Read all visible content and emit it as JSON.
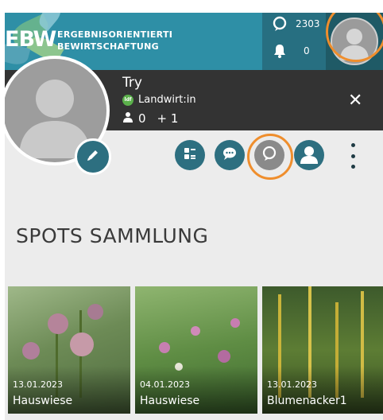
{
  "header": {
    "logo_abbr": "EBW",
    "logo_line1": "ERGEBNISORIENTIERTE",
    "logo_line2": "BEWIRTSCHAFTUNG",
    "points_value": "2303",
    "notifications_value": "0"
  },
  "profile": {
    "name": "Try",
    "role_badge": "ldf",
    "role": "Landwirt:in",
    "followers": "0",
    "following": "+ 1"
  },
  "section": {
    "title": "SPOTS SAMMLUNG"
  },
  "spots": [
    {
      "date": "13.01.2023",
      "name": "Hauswiese"
    },
    {
      "date": "04.01.2023",
      "name": "Hauswiese"
    },
    {
      "date": "13.01.2023",
      "name": "Blumenacker1"
    }
  ],
  "colors": {
    "header_teal": "#2e8fa6",
    "stats_teal": "#276f81",
    "profile_dark": "#333333",
    "accent_teal": "#2d6f80",
    "highlight_orange": "#ef8e2d",
    "role_green": "#5bb04b"
  },
  "icons": {
    "points": "speech-bubble-icon",
    "notifications": "bell-icon",
    "profile": "user-avatar-icon",
    "edit": "pencil-icon",
    "list": "list-icon",
    "chat": "chat-icon",
    "spot": "spot-icon",
    "user": "user-icon",
    "more": "vertical-dots-icon",
    "close": "close-icon"
  }
}
